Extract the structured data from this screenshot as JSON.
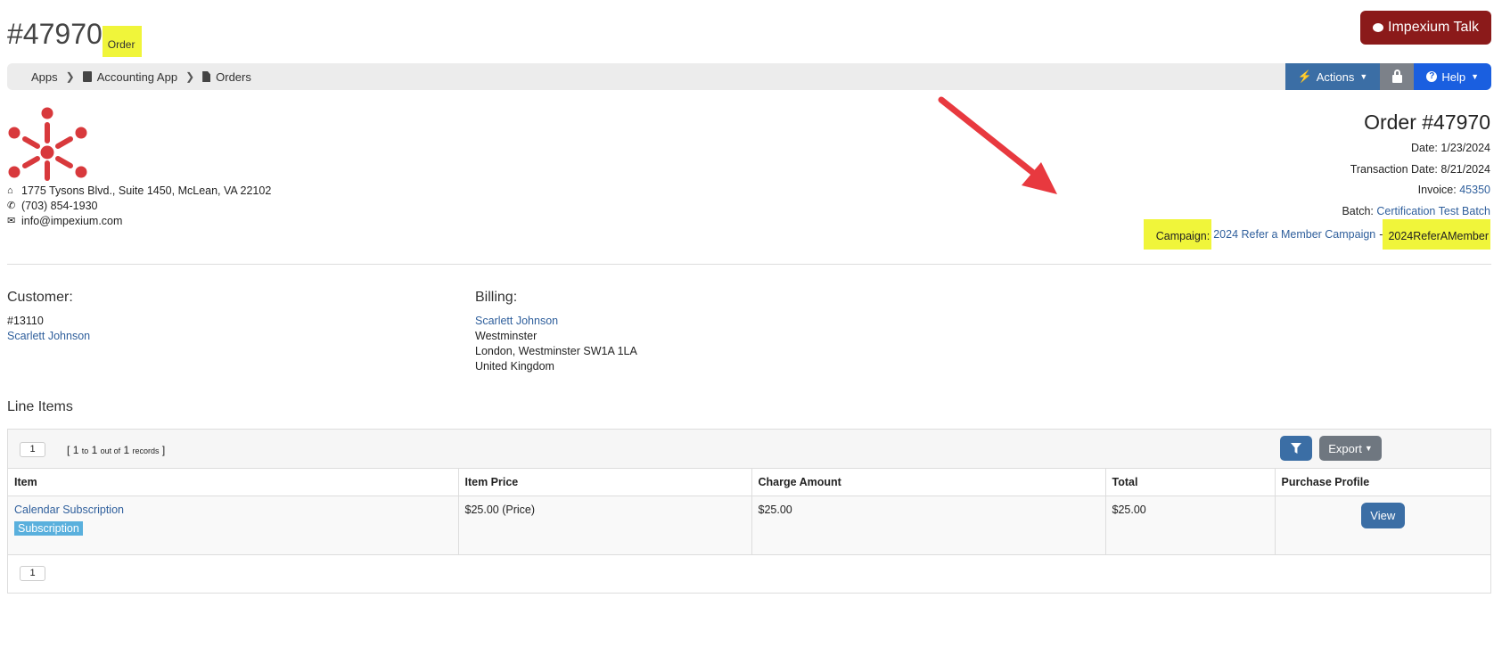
{
  "header": {
    "order_number": "#47970",
    "order_type": "Order",
    "talk_button": "Impexium Talk"
  },
  "breadcrumb": {
    "apps": "Apps",
    "accounting": "Accounting App",
    "orders": "Orders"
  },
  "toolbar": {
    "actions": "Actions",
    "help": "Help"
  },
  "company": {
    "address": "1775 Tysons Blvd., Suite 1450, McLean, VA 22102",
    "phone": "(703) 854-1930",
    "email": "info@impexium.com"
  },
  "order_info": {
    "title": "Order #47970",
    "date_label": "Date:",
    "date": "1/23/2024",
    "transaction_label": "Transaction Date:",
    "transaction_date": "8/21/2024",
    "invoice_label": "Invoice:",
    "invoice": "45350",
    "batch_label": "Batch:",
    "batch": "Certification Test Batch",
    "campaign_label": "Campaign:",
    "campaign_name": "2024 Refer a Member Campaign",
    "campaign_sep": "-",
    "campaign_code": "2024ReferAMember"
  },
  "customer": {
    "heading": "Customer:",
    "id": "#13110",
    "name": "Scarlett Johnson"
  },
  "billing": {
    "heading": "Billing:",
    "name": "Scarlett Johnson",
    "line1": "Westminster",
    "line2": "London, Westminster SW1A 1LA",
    "line3": "United Kingdom"
  },
  "line_items": {
    "heading": "Line Items",
    "page": "1",
    "records": {
      "open": "[",
      "from": "1",
      "to_word": "to",
      "to": "1",
      "out_of": "out of",
      "total": "1",
      "records_word": "records",
      "close": "]"
    },
    "export": "Export",
    "columns": [
      "Item",
      "Item Price",
      "Charge Amount",
      "Total",
      "Purchase Profile"
    ],
    "rows": [
      {
        "item": "Calendar Subscription",
        "badge": "Subscription",
        "price": "$25.00 (Price)",
        "charge": "$25.00",
        "total": "$25.00",
        "action": "View"
      }
    ],
    "bottom_page": "1"
  },
  "colors": {
    "highlight": "#f0f53a",
    "talk": "#8b1a1a",
    "primary": "#3b6ea5",
    "help": "#1a5fe0",
    "arrow": "#e8393f",
    "logo": "#d8393c"
  }
}
